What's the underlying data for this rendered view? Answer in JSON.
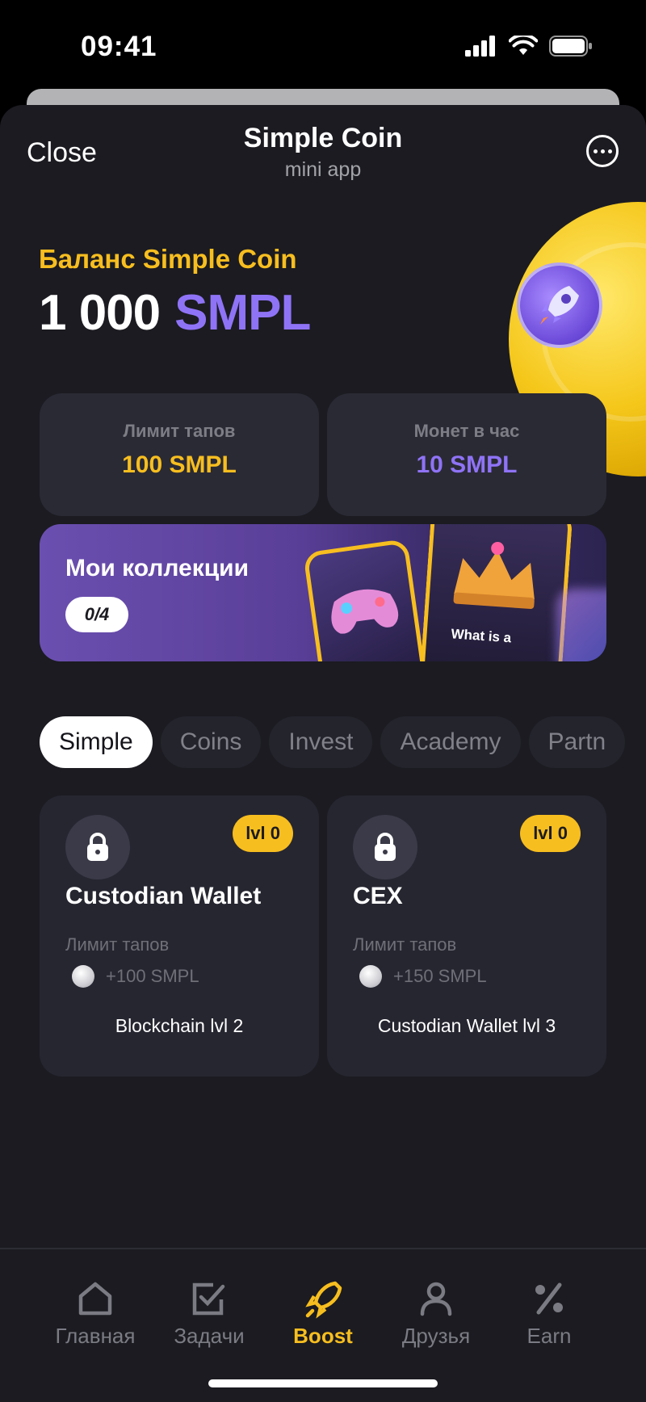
{
  "status_bar": {
    "time": "09:41"
  },
  "header": {
    "close_label": "Close",
    "title": "Simple Coin",
    "subtitle": "mini app"
  },
  "balance": {
    "label": "Баланс Simple Coin",
    "amount": "1 000",
    "unit": "SMPL"
  },
  "stats": [
    {
      "label": "Лимит тапов",
      "value": "100 SMPL",
      "color": "#f7be1f"
    },
    {
      "label": "Монет в час",
      "value": "10 SMPL",
      "color": "#8f73f6"
    }
  ],
  "collections": {
    "title": "Мои коллекции",
    "count": "0/4",
    "card_text": "What is a"
  },
  "tabs": [
    {
      "label": "Simple",
      "active": true
    },
    {
      "label": "Coins",
      "active": false
    },
    {
      "label": "Invest",
      "active": false
    },
    {
      "label": "Academy",
      "active": false
    },
    {
      "label": "Partn",
      "active": false
    }
  ],
  "upgrades": [
    {
      "title": "Custodian Wallet",
      "level": "lvl 0",
      "label": "Лимит тапов",
      "reward": "+100 SMPL",
      "requirement": "Blockchain lvl 2"
    },
    {
      "title": "CEX",
      "level": "lvl 0",
      "label": "Лимит тапов",
      "reward": "+150 SMPL",
      "requirement": "Custodian Wallet lvl 3"
    }
  ],
  "nav": [
    {
      "label": "Главная",
      "icon": "home-icon"
    },
    {
      "label": "Задачи",
      "icon": "tasks-icon"
    },
    {
      "label": "Boost",
      "icon": "rocket-icon",
      "active": true
    },
    {
      "label": "Друзья",
      "icon": "friends-icon"
    },
    {
      "label": "Earn",
      "icon": "percent-icon"
    }
  ],
  "colors": {
    "accent_yellow": "#f7be1f",
    "accent_purple": "#8f73f6",
    "background": "#1b1b21",
    "card": "#2a2a35"
  }
}
